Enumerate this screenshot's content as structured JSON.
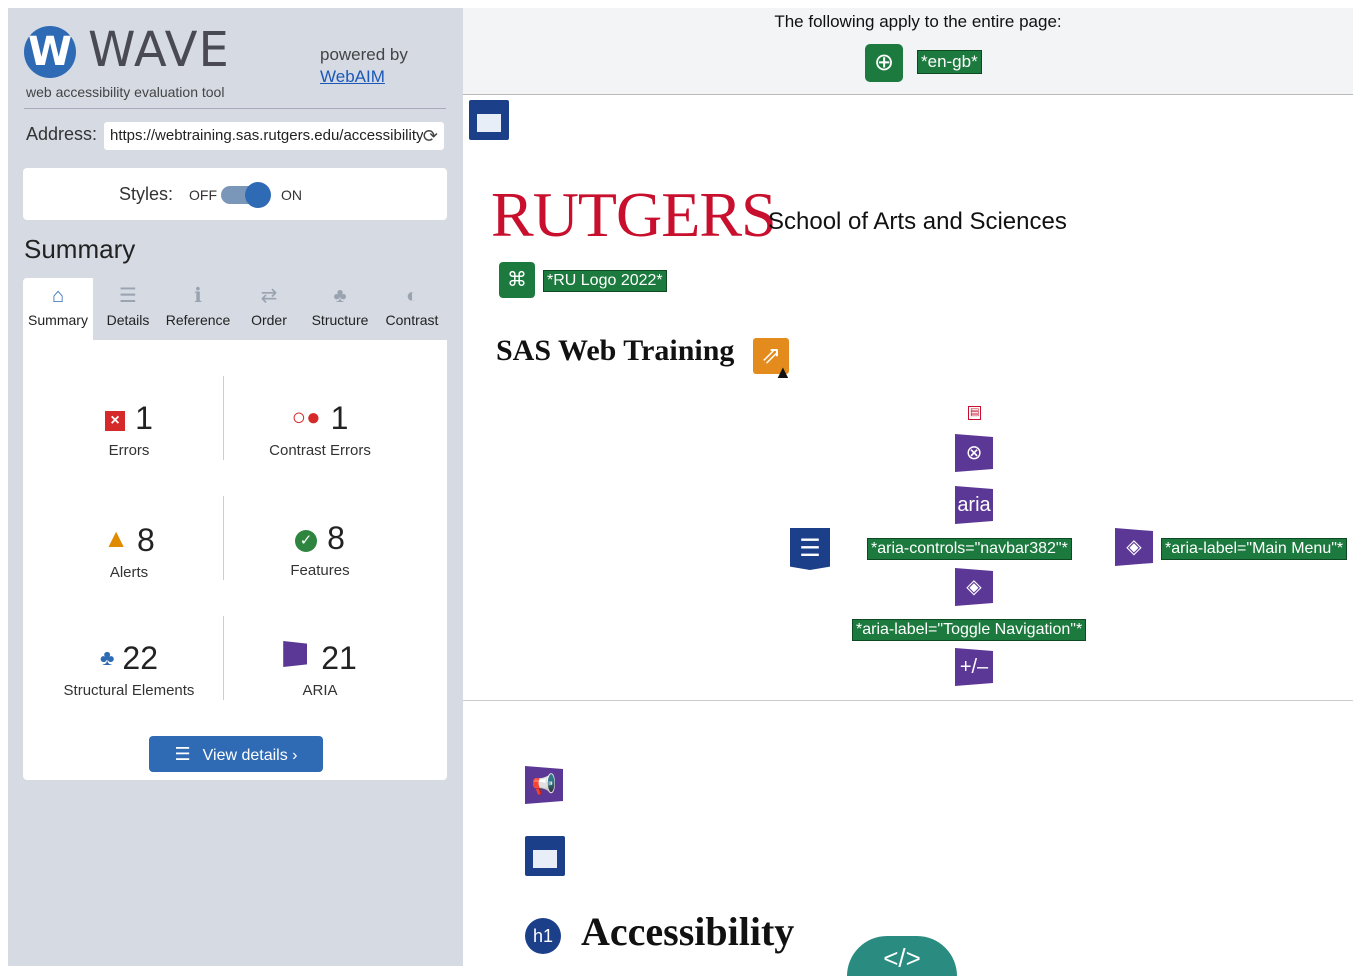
{
  "sidebar": {
    "logo_letter": "W",
    "title": "WAVE",
    "subtitle": "web accessibility evaluation tool",
    "powered_by": "powered by",
    "webaim_link": "WebAIM",
    "address_label": "Address:",
    "address_value": "https://webtraining.sas.rutgers.edu/accessibility",
    "styles_label": "Styles:",
    "styles_off": "OFF",
    "styles_on": "ON",
    "summary_heading": "Summary",
    "tabs": [
      {
        "label": "Summary",
        "icon": "home-icon",
        "glyph": "⌂"
      },
      {
        "label": "Details",
        "icon": "list-icon",
        "glyph": "☰"
      },
      {
        "label": "Reference",
        "icon": "info-icon",
        "glyph": "ℹ"
      },
      {
        "label": "Order",
        "icon": "order-icon",
        "glyph": "⇄"
      },
      {
        "label": "Structure",
        "icon": "structure-icon",
        "glyph": "♣"
      },
      {
        "label": "Contrast",
        "icon": "contrast-icon",
        "glyph": "◐"
      }
    ],
    "stats": {
      "errors": {
        "count": "1",
        "label": "Errors"
      },
      "contrast": {
        "count": "1",
        "label": "Contrast Errors"
      },
      "alerts": {
        "count": "8",
        "label": "Alerts"
      },
      "features": {
        "count": "8",
        "label": "Features"
      },
      "structural": {
        "count": "22",
        "label": "Structural Elements"
      },
      "aria": {
        "count": "21",
        "label": "ARIA"
      }
    },
    "view_details": "View details ›"
  },
  "main": {
    "top_notice": "The following apply to the entire page:",
    "lang_tag": "*en-gb*",
    "rutgers_brand": "RUTGERS",
    "school_name": "School of Arts and Sciences",
    "logo_tag": "*RU Logo 2022*",
    "site_title": "SAS Web Training",
    "aria_label": "aria",
    "aria_controls_tag": "*aria-controls=\"navbar382\"*",
    "aria_main_menu_tag": "*aria-label=\"Main Menu\"*",
    "aria_toggle_tag": "*aria-label=\"Toggle Navigation\"*",
    "expand_label": "+/–",
    "h1_badge": "h1",
    "page_heading": "Accessibility",
    "code_label": "</>"
  },
  "colors": {
    "sidebar_bg": "#d5dae3",
    "wave_blue": "#2f6bb5",
    "error_red": "#d62a2a",
    "alert_orange": "#e08a00",
    "feature_green": "#2e8540",
    "aria_purple": "#5c3896",
    "rutgers_red": "#c8102e",
    "wave_tag_green": "#1c7a3e"
  }
}
